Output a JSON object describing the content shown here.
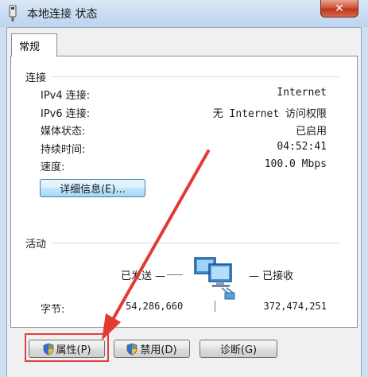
{
  "window": {
    "title": "本地连接 状态",
    "close_label": "✕"
  },
  "tabs": [
    {
      "label": "常规"
    }
  ],
  "connection": {
    "heading": "连接",
    "rows": [
      {
        "label": "IPv4 连接:",
        "value": "Internet"
      },
      {
        "label": "IPv6 连接:",
        "value": "无 Internet 访问权限"
      },
      {
        "label": "媒体状态:",
        "value": "已启用"
      },
      {
        "label": "持续时间:",
        "value": "04:52:41"
      },
      {
        "label": "速度:",
        "value": "100.0 Mbps"
      }
    ],
    "details_button": "详细信息(E)..."
  },
  "activity": {
    "heading": "活动",
    "sent_label": "已发送 —",
    "received_label": "— 已接收",
    "bytes_label": "字节:",
    "bytes_sent": "54,286,660",
    "bytes_received": "372,474,251"
  },
  "buttons": {
    "properties": "属性(P)",
    "disable": "禁用(D)",
    "diagnose": "诊断(G)"
  },
  "colors": {
    "highlight": "#e04040",
    "arrow": "#e23b34"
  }
}
